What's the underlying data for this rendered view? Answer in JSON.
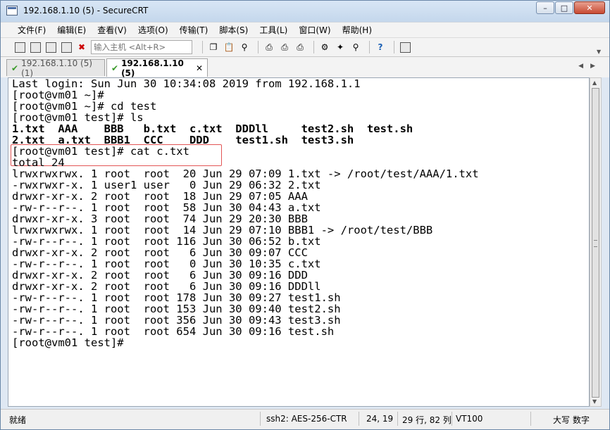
{
  "window": {
    "title": "192.168.1.10 (5) - SecureCRT"
  },
  "menu": [
    "文件(F)",
    "编辑(E)",
    "查看(V)",
    "选项(O)",
    "传输(T)",
    "脚本(S)",
    "工具(L)",
    "窗口(W)",
    "帮助(H)"
  ],
  "toolbar": {
    "host_placeholder": "输入主机 <Alt+R>"
  },
  "tabs": [
    {
      "label": "192.168.1.10 (5) (1)"
    },
    {
      "label": "192.168.1.10 (5)"
    }
  ],
  "terminal": {
    "lines": [
      "Last login: Sun Jun 30 10:34:08 2019 from 192.168.1.1",
      "[root@vm01 ~]#",
      "[root@vm01 ~]# cd test",
      "[root@vm01 test]# ls",
      "1.txt  AAA    BBB   b.txt  c.txt  DDDll     test2.sh  test.sh",
      "2.txt  a.txt  BBB1  CCC    DDD    test1.sh  test3.sh",
      "[root@vm01 test]# cat c.txt",
      "total 24",
      "lrwxrwxrwx. 1 root  root  20 Jun 29 07:09 1.txt -> /root/test/AAA/1.txt",
      "-rwxrwxr-x. 1 user1 user   0 Jun 29 06:32 2.txt",
      "drwxr-xr-x. 2 root  root  18 Jun 29 07:05 AAA",
      "-rw-r--r--. 1 root  root  58 Jun 30 04:43 a.txt",
      "drwxr-xr-x. 3 root  root  74 Jun 29 20:30 BBB",
      "lrwxrwxrwx. 1 root  root  14 Jun 29 07:10 BBB1 -> /root/test/BBB",
      "-rw-r--r--. 1 root  root 116 Jun 30 06:52 b.txt",
      "drwxr-xr-x. 2 root  root   6 Jun 30 09:07 CCC",
      "-rw-r--r--. 1 root  root   0 Jun 30 10:35 c.txt",
      "drwxr-xr-x. 2 root  root   6 Jun 30 09:16 DDD",
      "drwxr-xr-x. 2 root  root   6 Jun 30 09:16 DDDll",
      "-rw-r--r--. 1 root  root 178 Jun 30 09:27 test1.sh",
      "-rw-r--r--. 1 root  root 153 Jun 30 09:40 test2.sh",
      "-rw-r--r--. 1 root  root 356 Jun 30 09:43 test3.sh",
      "-rw-r--r--. 1 root  root 654 Jun 30 09:16 test.sh",
      "[root@vm01 test]#"
    ]
  },
  "status": {
    "ready": "就绪",
    "cipher": "ssh2: AES-256-CTR",
    "cursor": "24,  19",
    "size": "29 行, 82 列",
    "term": "VT100",
    "caps": "大写",
    "num": "数字"
  }
}
